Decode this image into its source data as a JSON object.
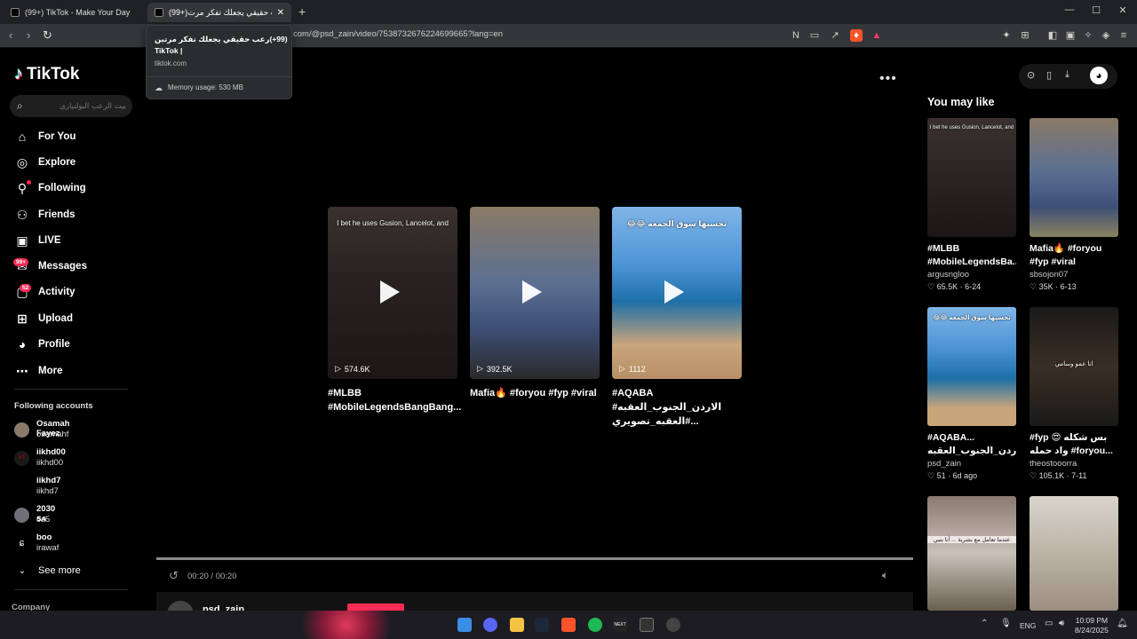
{
  "browser": {
    "tabs": [
      {
        "label": "(99+) TikTok - Make Your Day"
      },
      {
        "label": "(99+)رعب حقيقي يجعلك تفكر مرت..."
      }
    ],
    "url": "com/@psd_zain/video/7538732676224699665?lang=en",
    "window_controls": [
      "—",
      "☐",
      "✕"
    ]
  },
  "tooltip": {
    "title": "(99+)رعب حقيقي يجعلك تفكر مرتين | TikTok",
    "domain": "tiktok.com",
    "memory": "Memory usage: 530 MB"
  },
  "sidebar": {
    "logo": "TikTok",
    "search_placeholder": "بيت الرعب البولنيارى",
    "nav": [
      {
        "label": "For You",
        "icon": "home-icon"
      },
      {
        "label": "Explore",
        "icon": "compass-icon"
      },
      {
        "label": "Following",
        "icon": "following-icon"
      },
      {
        "label": "Friends",
        "icon": "friends-icon"
      },
      {
        "label": "LIVE",
        "icon": "live-icon"
      },
      {
        "label": "Messages",
        "icon": "messages-icon",
        "badge": "99+"
      },
      {
        "label": "Activity",
        "icon": "activity-icon",
        "badge": "52"
      },
      {
        "label": "Upload",
        "icon": "upload-icon"
      },
      {
        "label": "Profile",
        "icon": "profile-icon"
      },
      {
        "label": "More",
        "icon": "more-icon"
      }
    ],
    "following_heading": "Following accounts",
    "accounts": [
      {
        "name": "Osamah Fayez",
        "handle": "osamahf"
      },
      {
        "name": "iikhd00",
        "handle": "iikhd00"
      },
      {
        "name": "iikhd7",
        "handle": "iikhd7"
      },
      {
        "name": "2030 ꜱᴀ",
        "handle": "ca5"
      },
      {
        "name": "boo",
        "handle": "irawaf"
      }
    ],
    "see_more": "See more",
    "company": "Company"
  },
  "main": {
    "videos": [
      {
        "views": "574.6K",
        "caption": "#MLBB #MobileLegendsBangBang...",
        "overlay": "I bet he uses Gusion, Lancelot, and"
      },
      {
        "views": "392.5K",
        "caption": "Mafia🔥 #foryou #fyp #viral",
        "overlay": ""
      },
      {
        "views": "1112",
        "caption": "#AQABA الاردن_الجنوب_العقبه# العقبه_تصويري#...",
        "overlay": "😂😂 تحسبها سوق الجمعه"
      }
    ],
    "timecode": "00:20 / 00:20",
    "author": "psd_zain"
  },
  "right_panel": {
    "heading": "You may like",
    "cards": [
      {
        "caption": "#MLBB #MobileLegendsBa...",
        "user": "argusngloo",
        "likes": "65.5K",
        "date": "6-24",
        "overlay": "I bet he uses Gusion, Lancelot, and"
      },
      {
        "caption": "Mafia🔥 #foryou #fyp #viral",
        "user": "sbsojon07",
        "likes": "35K",
        "date": "6-13",
        "overlay": ""
      },
      {
        "caption": "#AQABA... الاردن_الجنوب_العقبه#",
        "user": "psd_zain",
        "likes": "51",
        "date": "6d ago",
        "overlay": "😂😂 تحسبها سوق الجمعه"
      },
      {
        "caption": "#fyp 😍 بس شكله واد حمله #foryou...",
        "user": "theostooorra",
        "likes": "105.1K",
        "date": "7-11",
        "overlay": "انا عمو وسامي"
      },
      {
        "caption": "",
        "user": "",
        "likes": "",
        "date": "",
        "overlay": "عندما تعامل مع بشرية ... أنا بتبي"
      },
      {
        "caption": "",
        "user": "",
        "likes": "",
        "date": "",
        "overlay": ""
      }
    ]
  },
  "taskbar": {
    "lang": "ENG",
    "time": "10:09 PM",
    "date": "8/24/2025"
  }
}
